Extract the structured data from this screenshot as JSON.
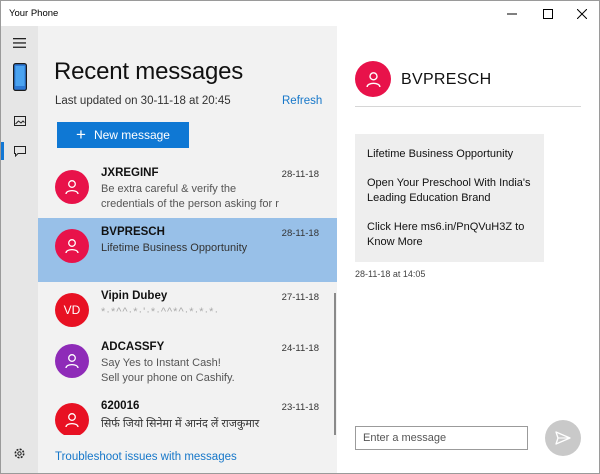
{
  "window": {
    "title": "Your Phone"
  },
  "list": {
    "title": "Recent messages",
    "last_updated": "Last updated on 30-11-18 at 20:45",
    "refresh_label": "Refresh",
    "new_message_label": "New message",
    "troubleshoot_label": "Troubleshoot issues with messages",
    "conversations": [
      {
        "name": "JXREGINF",
        "date": "28-11-18",
        "line1": "Be extra careful & verify the",
        "line2": "credentials of the person asking for r",
        "avatar_color": "#e8124a",
        "initials": ""
      },
      {
        "name": "BVPRESCH",
        "date": "28-11-18",
        "line1": "Lifetime Business Opportunity",
        "line2": "",
        "avatar_color": "#e8124a",
        "initials": ""
      },
      {
        "name": "Vipin Dubey",
        "date": "27-11-18",
        "line1": "*·*^^·*·'·*·^^*^·*·*·*·",
        "line2": "",
        "avatar_color": "#e81123",
        "initials": "VD"
      },
      {
        "name": "ADCASSFY",
        "date": "24-11-18",
        "line1": "Say Yes to Instant Cash!",
        "line2": "Sell your phone on Cashify.",
        "avatar_color": "#8e2bb8",
        "initials": ""
      },
      {
        "name": "620016",
        "date": "23-11-18",
        "line1": "सिर्फ जियो सिनेमा में आनंद लें राजकुमार",
        "line2": "",
        "avatar_color": "#e81123",
        "initials": ""
      }
    ]
  },
  "chat": {
    "contact": "BVPRESCH",
    "message_paragraphs": [
      "Lifetime Business Opportunity",
      "Open Your Preschool With India's Leading Education Brand",
      "Click Here ms6.in/PnQVuH3Z to Know More"
    ],
    "timestamp": "28-11-18 at 14:05",
    "input_placeholder": "Enter a message"
  },
  "colors": {
    "accent": "#0f78d4",
    "selected_row": "#98c0e8",
    "avatar_pink": "#e8124a",
    "avatar_purple": "#8e2bb8"
  },
  "icons": [
    "minimize-icon",
    "maximize-icon",
    "close-icon",
    "hamburger-icon",
    "phone-icon",
    "photos-icon",
    "messages-icon",
    "settings-icon",
    "person-icon",
    "send-icon"
  ]
}
